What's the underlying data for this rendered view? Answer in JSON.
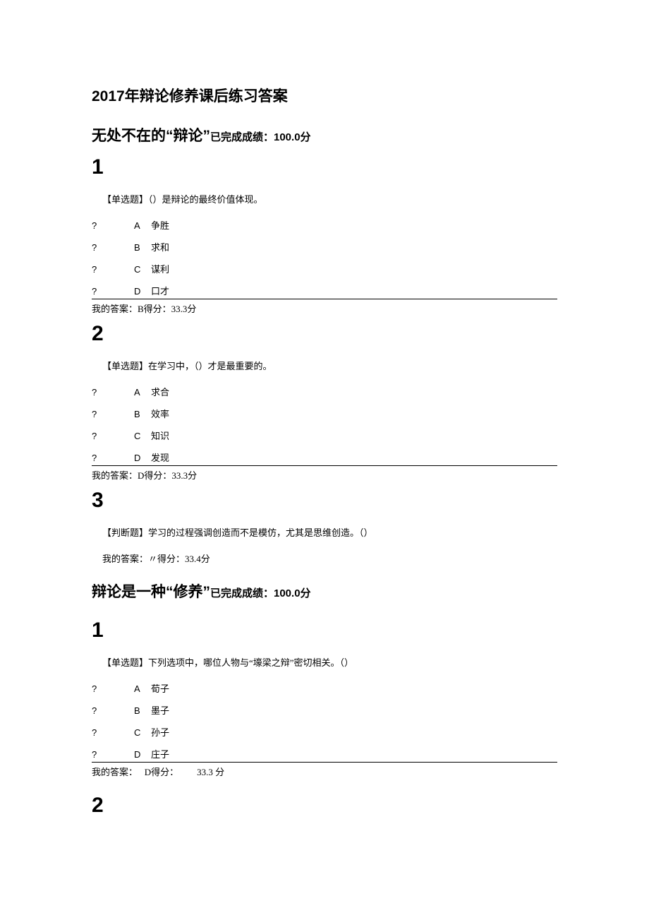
{
  "doc_title": "2017年辩论修养课后练习答案",
  "sections": [
    {
      "heading_main": "无处不在的“辩论”",
      "heading_suffix": "已完成成绩：100.0分",
      "questions": [
        {
          "num": "1",
          "stem": "【单选题】（）是辩论的最终价值体现。",
          "options": [
            {
              "mark": "?",
              "letter": "A",
              "text": "争胜"
            },
            {
              "mark": "?",
              "letter": "B",
              "text": "求和"
            },
            {
              "mark": "?",
              "letter": "C",
              "text": "谋利"
            },
            {
              "mark": "?",
              "letter": "D",
              "text": "口才"
            }
          ],
          "answer_line": "我的答案：B得分：33.3分"
        },
        {
          "num": "2",
          "stem": "【单选题】在学习中，（）才是最重要的。",
          "options": [
            {
              "mark": "?",
              "letter": "A",
              "text": "求合"
            },
            {
              "mark": "?",
              "letter": "B",
              "text": "效率"
            },
            {
              "mark": "?",
              "letter": "C",
              "text": "知识"
            },
            {
              "mark": "?",
              "letter": "D",
              "text": "发现"
            }
          ],
          "answer_line": "我的答案：D得分：33.3分"
        },
        {
          "num": "3",
          "stem": "【判断题】学习的过程强调创造而不是模仿，尤其是思维创造。（）",
          "tf_prefix": "我的答案：",
          "tf_symbol": "〃",
          "tf_suffix": "得分：33.4分"
        }
      ]
    },
    {
      "heading_main": "辩论是一种“修养”",
      "heading_suffix": "已完成成绩：100.0分",
      "questions": [
        {
          "num": "1",
          "stem": "【单选题】下列选项中，哪位人物与“壕梁之辩”密切相关。（）",
          "options": [
            {
              "mark": "?",
              "letter": "A",
              "text": "荀子"
            },
            {
              "mark": "?",
              "letter": "B",
              "text": "墨子"
            },
            {
              "mark": "?",
              "letter": "C",
              "text": "孙子"
            },
            {
              "mark": "?",
              "letter": "D",
              "text": "庄子"
            }
          ],
          "answer_prefix": "我的答案：",
          "answer_choice": "D",
          "answer_score_label": "得分：",
          "answer_score_value": "33.3 分"
        },
        {
          "num": "2"
        }
      ]
    }
  ]
}
